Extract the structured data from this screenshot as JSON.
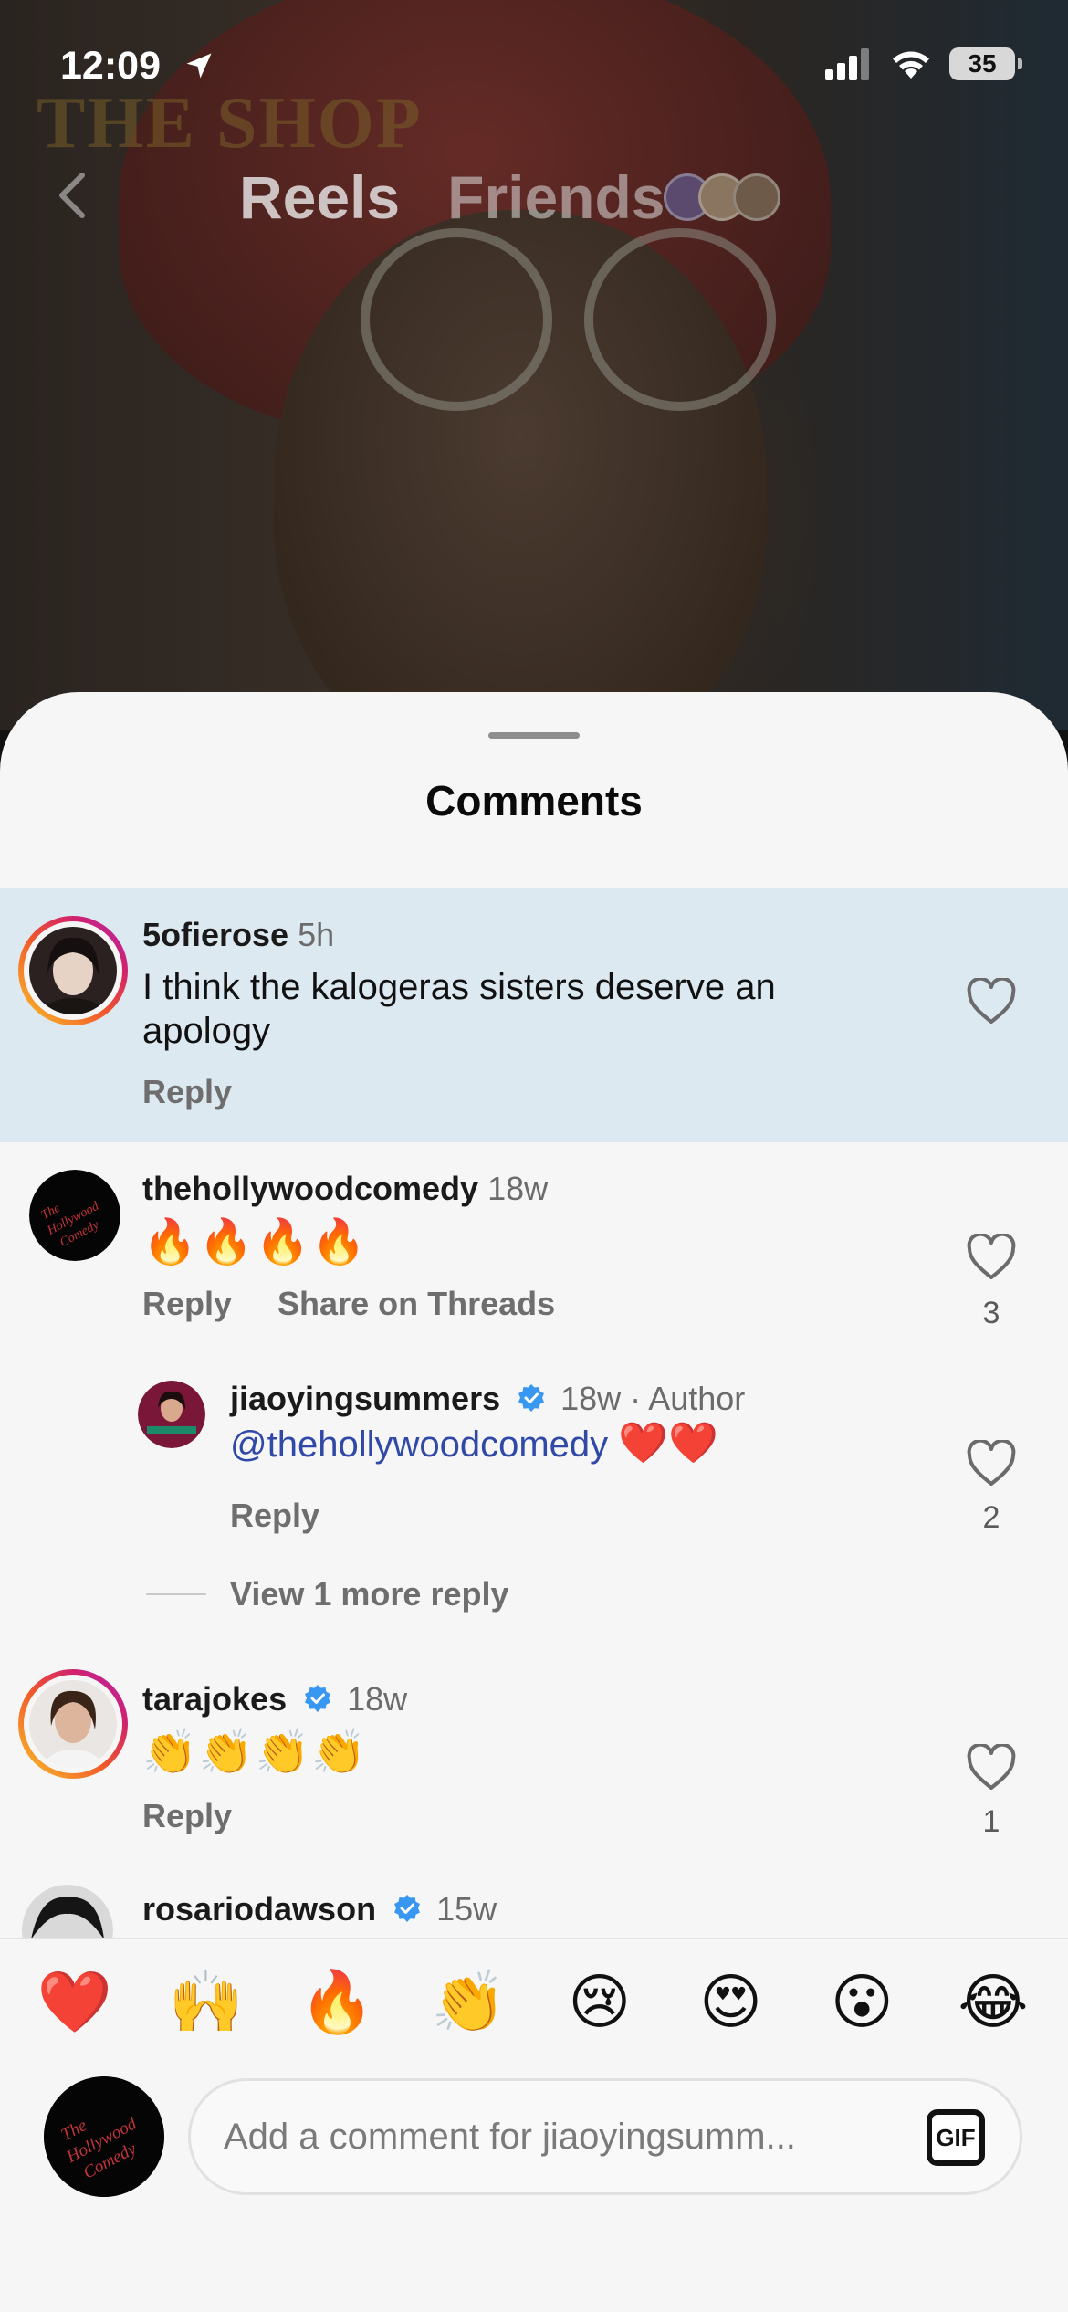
{
  "status_bar": {
    "time": "12:09",
    "battery": "35"
  },
  "top_nav": {
    "background_text": "THE SHOP",
    "tabs": [
      {
        "label": "Reels"
      },
      {
        "label": "Friends"
      }
    ]
  },
  "sheet": {
    "title": "Comments"
  },
  "comments": [
    {
      "username": "5ofierose",
      "time": "5h",
      "text": "I think the kalogeras sisters deserve an apology",
      "reply_label": "Reply"
    },
    {
      "username": "thehollywoodcomedy",
      "time": "18w",
      "emojis": "🔥🔥🔥🔥",
      "reply_label": "Reply",
      "share_label": "Share on Threads",
      "likes": "3",
      "avatar_text": "The Hollywood Comedy"
    },
    {
      "username": "jiaoyingsummers",
      "time": "18w · Author",
      "mention": "@thehollywoodcomedy",
      "emojis": "❤️❤️",
      "reply_label": "Reply",
      "likes": "2"
    },
    {
      "username": "tarajokes",
      "time": "18w",
      "emojis": "👏👏👏👏",
      "reply_label": "Reply",
      "likes": "1"
    },
    {
      "username": "rosariodawson",
      "time": "15w"
    }
  ],
  "more_replies": "View 1 more reply",
  "composer": {
    "quick_emojis": [
      "❤️",
      "🙌",
      "🔥",
      "👏",
      "😢",
      "😍",
      "😮",
      "😂"
    ],
    "placeholder": "Add a comment for jiaoyingsumm...",
    "gif_label": "GIF",
    "avatar_text": "The Hollywood Comedy"
  },
  "colors": {
    "highlight": "#dde9f1",
    "mention": "#3149a6",
    "verified": "#3897f0",
    "sheet_bg": "#f6f6f6"
  }
}
